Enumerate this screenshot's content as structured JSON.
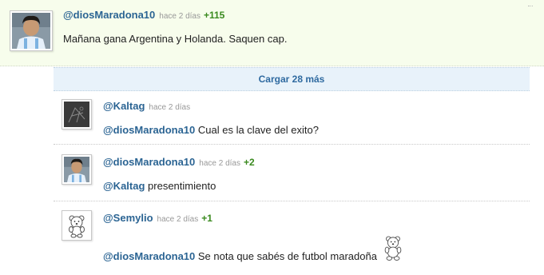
{
  "main_post": {
    "user": "@diosMaradona10",
    "time": "hace 2 días",
    "votes": "+115",
    "text": "Mañana gana Argentina y Holanda. Saquen cap."
  },
  "load_more": {
    "label": "Cargar 28 más"
  },
  "replies": [
    {
      "user": "@Kaltag",
      "time": "hace 2 días",
      "votes": "",
      "mention": "@diosMaradona10",
      "text": "Cual es la clave del exito?"
    },
    {
      "user": "@diosMaradona10",
      "time": "hace 2 días",
      "votes": "+2",
      "mention": "@Kaltag",
      "text": "presentimiento"
    },
    {
      "user": "@Semylio",
      "time": "hace 2 días",
      "votes": "+1",
      "mention": "@diosMaradona10",
      "text": "Se nota que sabés de futbol maradoña"
    }
  ],
  "icons": [
    "maradona-avatar",
    "kaltag-avatar",
    "teddy-bear-avatar",
    "teddy-bear-emoticon"
  ],
  "colors": {
    "username": "#2b6493",
    "votes": "#3a8a1f",
    "main_bg": "#f7fdec",
    "load_more_bg": "#e8f2fa"
  }
}
